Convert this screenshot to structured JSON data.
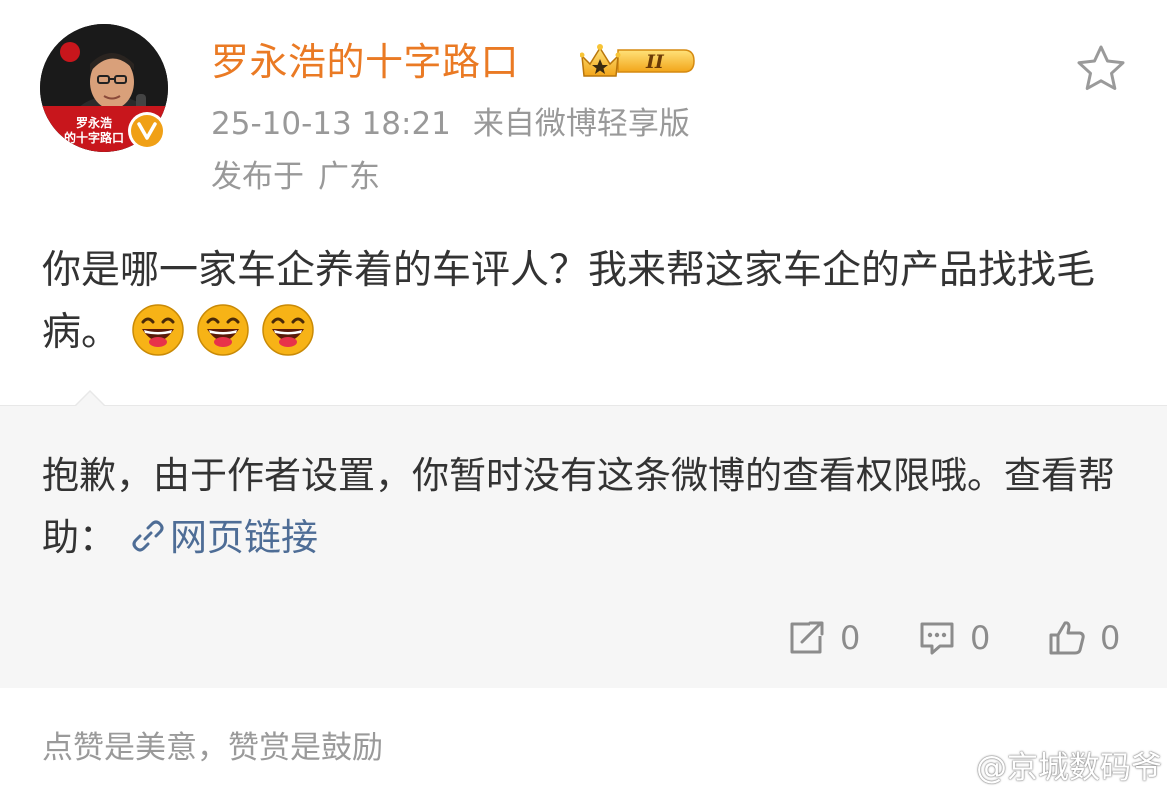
{
  "header": {
    "username": "罗永浩的十字路口",
    "level_badge": "II",
    "timestamp": "25-10-13 18:21",
    "source": "来自微博轻享版",
    "location_prefix": "发布于",
    "location": "广东",
    "avatar_caption_line1": "罗永浩",
    "avatar_caption_line2": "的十字路口"
  },
  "post": {
    "text": "你是哪一家车企养着的车评人？我来帮这家车企的产品找找毛病。",
    "emoji_count": 3,
    "emoji_name": "laughing-face-icon"
  },
  "repost": {
    "notice": "抱歉，由于作者设置，你暂时没有这条微博的查看权限哦。查看帮助：",
    "link_text": "网页链接"
  },
  "actions": {
    "repost_count": "0",
    "comment_count": "0",
    "like_count": "0"
  },
  "footer": {
    "hint": "点赞是美意，赞赏是鼓励",
    "watermark": "@京城数码爷"
  },
  "colors": {
    "username": "#ea7a24",
    "meta": "#999999",
    "link": "#4e6d96",
    "card_bg": "#f6f6f6",
    "verified": "#f0a016"
  }
}
